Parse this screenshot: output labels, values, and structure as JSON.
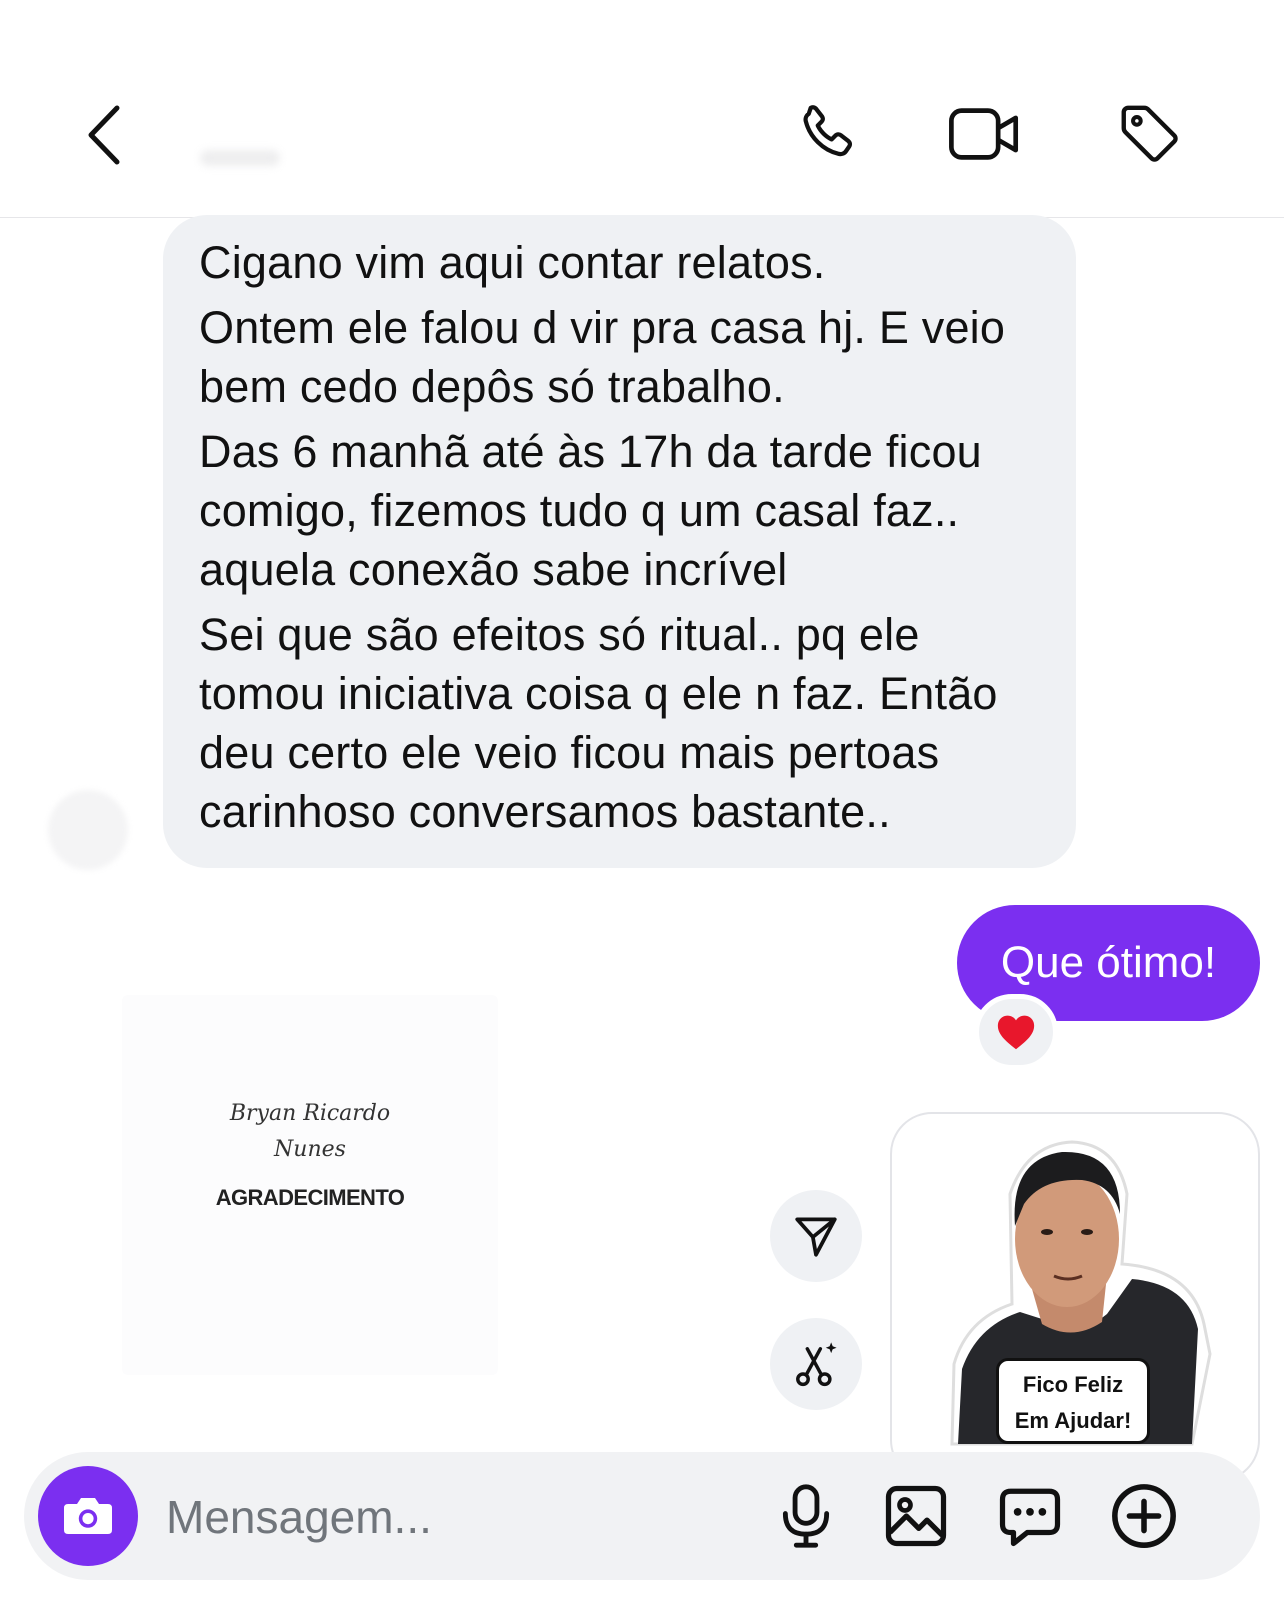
{
  "header": {
    "back_icon": "chevron-left-icon",
    "call_icon": "phone-icon",
    "video_icon": "video-camera-icon",
    "tag_icon": "tag-icon"
  },
  "conversation": {
    "incoming_paragraphs": [
      "Cigano vim aqui contar relatos.",
      "Ontem ele falou d vir pra casa hj. E veio bem cedo depôs só trabalho.",
      "Das 6 manhã até às 17h da tarde ficou comigo, fizemos tudo q um casal faz.. aquela conexão sabe incrível",
      "Sei que são efeitos só ritual..  pq ele tomou iniciativa coisa q ele n faz. Então deu certo ele veio ficou mais pertoas carinhoso conversamos bastante.."
    ],
    "outgoing_message": "Que ótimo!",
    "reaction_emoji": "❤️",
    "card": {
      "script_line_1": "Bryan Ricardo",
      "script_line_2": "Nunes",
      "title": "AGRADECIMENTO"
    },
    "sticker": {
      "line_1": "Fico Feliz",
      "line_2": "Em Ajudar!"
    }
  },
  "composer": {
    "placeholder": "Mensagem...",
    "camera_icon": "camera-icon",
    "mic_icon": "microphone-icon",
    "gallery_icon": "image-icon",
    "sticker_icon": "chat-dots-icon",
    "add_icon": "plus-circle-icon"
  },
  "colors": {
    "accent": "#7b2ff0",
    "incoming_bubble": "#eff1f4",
    "background": "#ffffff"
  }
}
